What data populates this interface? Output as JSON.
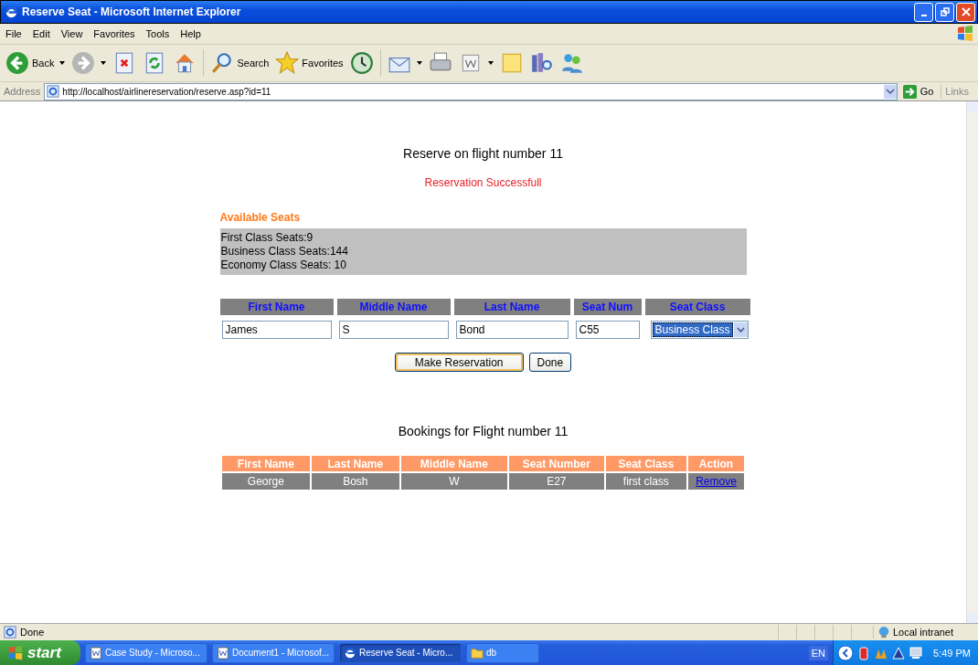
{
  "window": {
    "title": "Reserve Seat - Microsoft Internet Explorer"
  },
  "menu": [
    "File",
    "Edit",
    "View",
    "Favorites",
    "Tools",
    "Help"
  ],
  "toolbar": [
    {
      "kind": "back",
      "label": "Back",
      "dropdown": true
    },
    {
      "kind": "forward",
      "dropdown": true
    },
    {
      "kind": "stop"
    },
    {
      "kind": "refresh"
    },
    {
      "kind": "home"
    },
    {
      "kind": "search",
      "label": "Search"
    },
    {
      "kind": "favorites",
      "label": "Favorites"
    },
    {
      "kind": "history"
    },
    {
      "kind": "mail",
      "dropdown": true
    },
    {
      "kind": "print"
    },
    {
      "kind": "edit",
      "dropdown": true
    },
    {
      "kind": "note"
    },
    {
      "kind": "research"
    },
    {
      "kind": "messenger"
    }
  ],
  "address_bar": {
    "label": "Address",
    "url": "http://localhost/airlinereservation/reserve.asp?id=11",
    "go": "Go",
    "links": "Links"
  },
  "page": {
    "heading": "Reserve on flight number 11",
    "message": "Reservation Successfull",
    "available_title": "Available Seats",
    "available_lines": [
      "First Class Seats:9",
      "Business Class Seats:144",
      "Economy Class Seats: 10"
    ],
    "form_columns": [
      "First Name",
      "Middle Name",
      "Last Name",
      "Seat Num",
      "Seat Class"
    ],
    "form_values": [
      {
        "kind": "text",
        "value": "James"
      },
      {
        "kind": "text",
        "value": "S"
      },
      {
        "kind": "text",
        "value": "Bond"
      },
      {
        "kind": "text",
        "value": "C55"
      },
      {
        "kind": "select",
        "value": "Business Class"
      }
    ],
    "buttons": [
      {
        "label": "Make Reservation",
        "focused": true
      },
      {
        "label": "Done",
        "focused": false
      }
    ],
    "bookings_heading": "Bookings for Flight number 11",
    "bookings_columns": [
      "First Name",
      "Last Name",
      "Middle Name",
      "Seat Number",
      "Seat Class",
      "Action"
    ],
    "bookings_rows": [
      {
        "cells": [
          "George",
          "Bosh",
          "W",
          "E27",
          "first class"
        ],
        "action": "Remove"
      }
    ]
  },
  "status_bar": {
    "text": "Done",
    "zone": "Local intranet"
  },
  "taskbar": {
    "start": "start",
    "tasks": [
      {
        "kind": "word",
        "label": "Case Study - Microso...",
        "selected": false
      },
      {
        "kind": "word",
        "label": "Document1 - Microsof...",
        "selected": false
      },
      {
        "kind": "ie",
        "label": "Reserve Seat - Micro...",
        "selected": true
      },
      {
        "kind": "folder",
        "label": "db",
        "selected": false
      }
    ],
    "language": "EN",
    "clock": "5:49 PM"
  }
}
